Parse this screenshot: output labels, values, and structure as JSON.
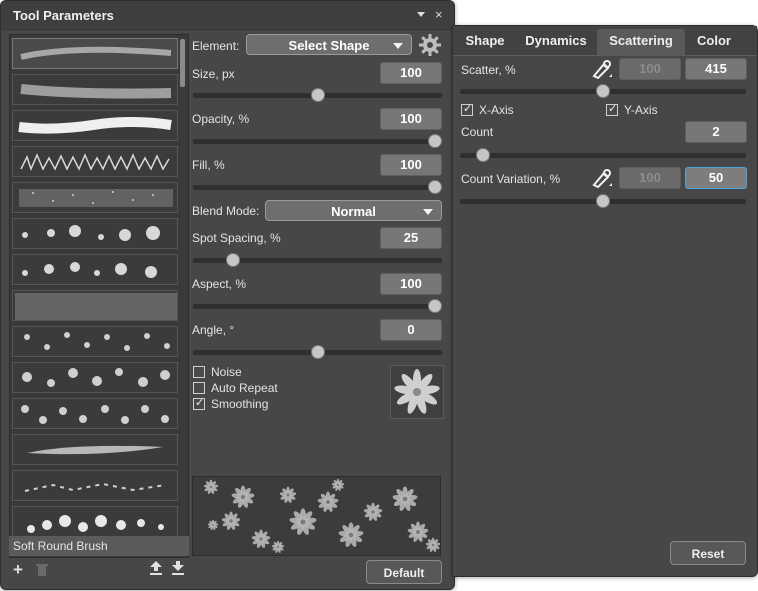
{
  "tool_panel": {
    "title": "Tool Parameters",
    "selected_brush": "Soft Round Brush",
    "element_label": "Element:",
    "element_value": "Select Shape",
    "params": {
      "size": {
        "label": "Size, px",
        "value": "100",
        "fraction": 0.5
      },
      "opacity": {
        "label": "Opacity, %",
        "value": "100",
        "fraction": 1.0
      },
      "fill": {
        "label": "Fill, %",
        "value": "100",
        "fraction": 1.0
      },
      "spot_spacing": {
        "label": "Spot Spacing, %",
        "value": "25",
        "fraction": 0.14
      },
      "aspect": {
        "label": "Aspect, %",
        "value": "100",
        "fraction": 1.0
      },
      "angle": {
        "label": "Angle, °",
        "value": "0",
        "fraction": 0.5
      }
    },
    "blend_mode_label": "Blend Mode:",
    "blend_mode_value": "Normal",
    "noise_label": "Noise",
    "auto_repeat_label": "Auto Repeat",
    "smoothing_label": "Smoothing",
    "noise_checked": false,
    "auto_repeat_checked": false,
    "smoothing_checked": true,
    "default_button": "Default"
  },
  "scatter_panel": {
    "tabs": [
      "Shape",
      "Dynamics",
      "Scattering",
      "Color"
    ],
    "active_tab": "Scattering",
    "scatter": {
      "label": "Scatter, %",
      "dim_value": "100",
      "value": "415",
      "fraction": 0.5
    },
    "x_axis_label": "X-Axis",
    "y_axis_label": "Y-Axis",
    "x_axis_checked": true,
    "y_axis_checked": true,
    "count": {
      "label": "Count",
      "value": "2",
      "fraction": 0.06
    },
    "count_variation": {
      "label": "Count Variation, %",
      "dim_value": "100",
      "value": "50",
      "fraction": 0.5
    },
    "reset_button": "Reset"
  },
  "colors": {
    "panel_bg": "#474747",
    "accent": "#4ea3e0"
  }
}
